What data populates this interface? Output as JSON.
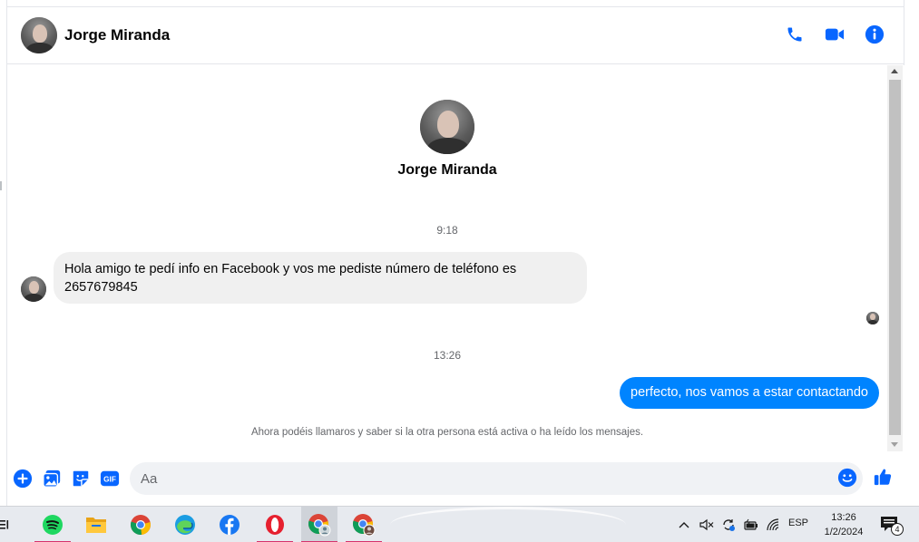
{
  "header": {
    "contact_name": "Jorge Miranda",
    "actions": [
      "phone-icon",
      "video-call-icon",
      "info-icon"
    ]
  },
  "profile": {
    "name": "Jorge Miranda"
  },
  "conversation": {
    "timestamp_1": "9:18",
    "incoming_message": "Hola amigo te pedí info en Facebook y vos me pediste número de teléfono es 2657679845",
    "timestamp_2": "13:26",
    "outgoing_message": "perfecto, nos vamos a estar contactando",
    "footer_note": "Ahora podéis llamaros y saber si la otra persona está activa o ha leído los mensajes."
  },
  "composer": {
    "placeholder": "Aa",
    "value": "",
    "gif_label": "GIF"
  },
  "taskbar": {
    "apps": [
      "spotify-icon",
      "file-explorer-icon",
      "chrome-icon",
      "edge-icon",
      "facebook-icon",
      "opera-icon",
      "chrome-profile-icon",
      "chrome-profile-icon"
    ],
    "language": "ESP",
    "time": "13:26",
    "date": "1/2/2024",
    "notification_count": "4"
  },
  "colors": {
    "accent": "#0084ff",
    "messenger_blue": "#0866ff",
    "incoming_bubble": "#f0f0f0",
    "text_secondary": "#65676b"
  }
}
